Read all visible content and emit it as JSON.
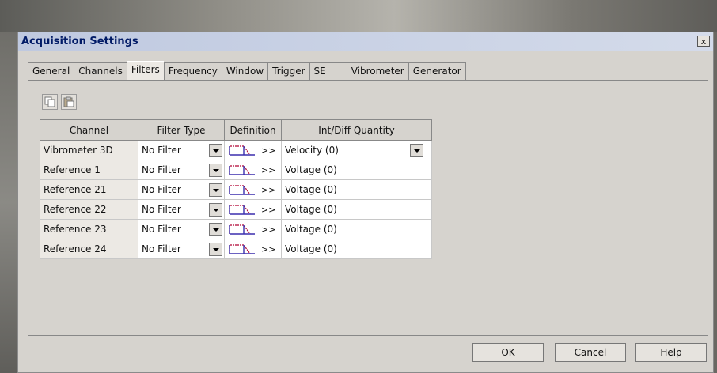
{
  "dialog": {
    "title": "Acquisition Settings",
    "close_label": "x"
  },
  "tabs": [
    "General",
    "Channels",
    "Filters",
    "Frequency",
    "Window",
    "Trigger",
    "SE",
    "Vibrometer",
    "Generator"
  ],
  "active_tab": "Filters",
  "toolbar": {
    "copy_icon": "copy-icon",
    "paste_icon": "paste-icon"
  },
  "table": {
    "headers": {
      "channel": "Channel",
      "filter_type": "Filter Type",
      "definition": "Definition",
      "quantity": "Int/Diff Quantity"
    },
    "definition_arrow": ">>",
    "rows": [
      {
        "channel": "Vibrometer 3D",
        "filter_type": "No Filter",
        "quantity": "Velocity (0)"
      },
      {
        "channel": "Reference 1",
        "filter_type": "No Filter",
        "quantity": "Voltage (0)"
      },
      {
        "channel": "Reference 21",
        "filter_type": "No Filter",
        "quantity": "Voltage (0)"
      },
      {
        "channel": "Reference 22",
        "filter_type": "No Filter",
        "quantity": "Voltage (0)"
      },
      {
        "channel": "Reference 23",
        "filter_type": "No Filter",
        "quantity": "Voltage (0)"
      },
      {
        "channel": "Reference 24",
        "filter_type": "No Filter",
        "quantity": "Voltage (0)"
      }
    ]
  },
  "buttons": {
    "ok": "OK",
    "cancel": "Cancel",
    "help": "Help"
  }
}
